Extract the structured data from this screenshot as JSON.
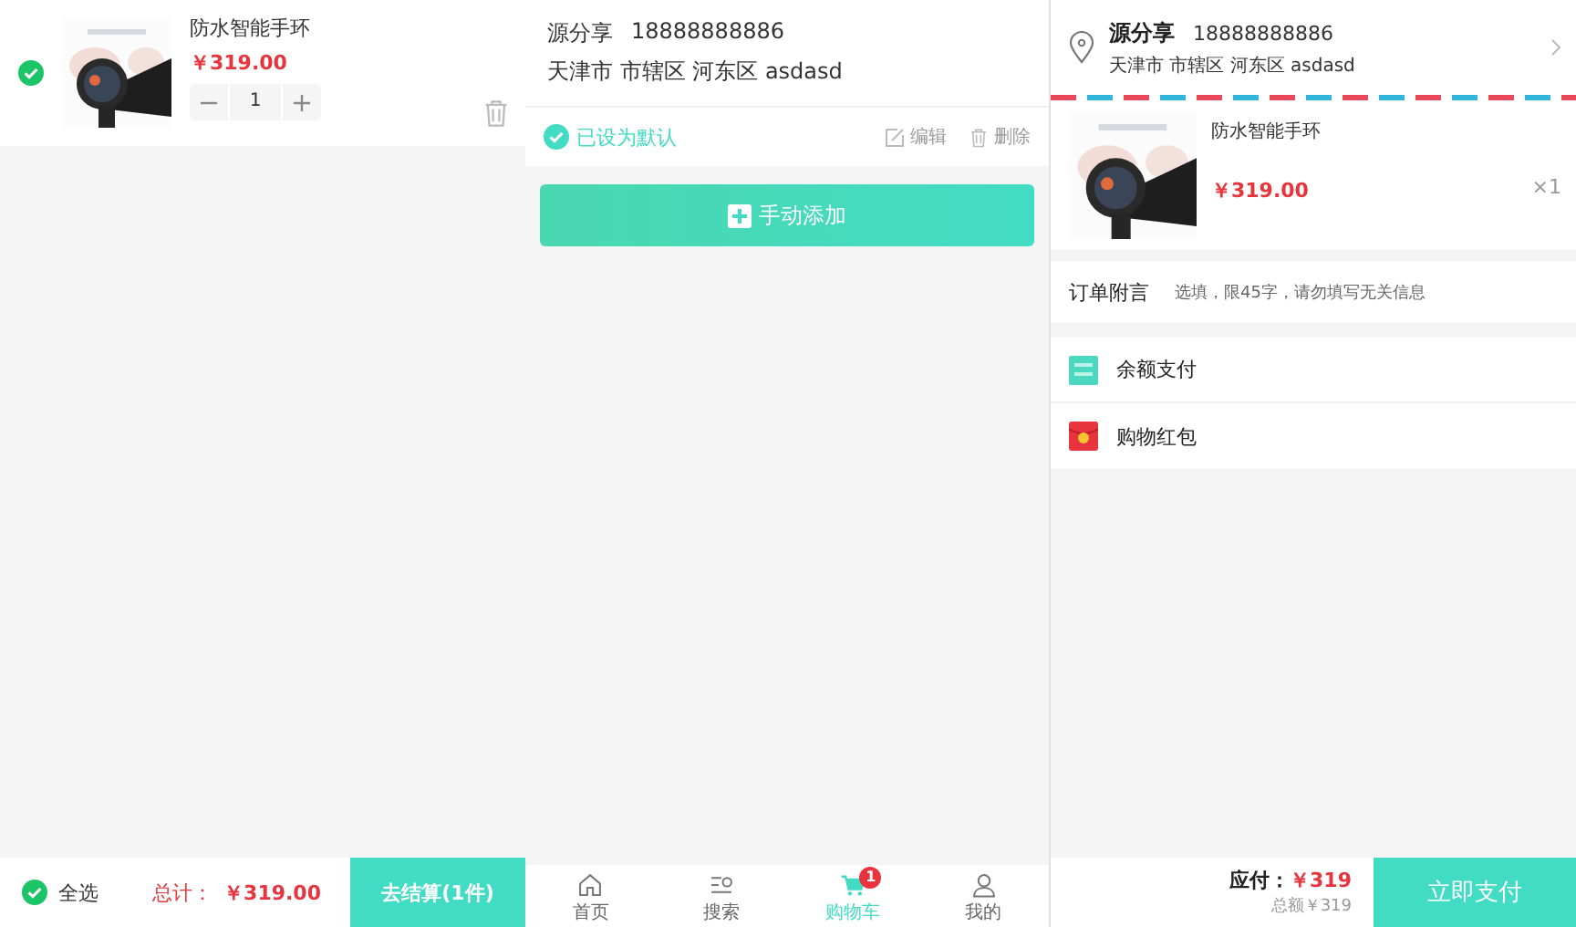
{
  "cart": {
    "items": [
      {
        "title": "防水智能手环",
        "price": "￥319.00",
        "quantity": "1",
        "checked": true
      }
    ],
    "footer": {
      "select_all": {
        "label": "全选",
        "checked": true
      },
      "total_label": "总计：",
      "total": "￥319.00",
      "checkout_button": "去结算(1件)"
    }
  },
  "address_list": {
    "addresses": [
      {
        "name": "源分享",
        "phone": "18888888886",
        "address": "天津市 市辖区 河东区 asdasd",
        "default": true,
        "default_label": "已设为默认",
        "edit": "编辑",
        "delete": "删除"
      }
    ],
    "add_button": "手动添加",
    "tabbar": [
      {
        "label": "首页",
        "kind": "home",
        "selected": false
      },
      {
        "label": "搜索",
        "kind": "search",
        "selected": false
      },
      {
        "label": "购物车",
        "kind": "cart",
        "selected": true,
        "badge": "1"
      },
      {
        "label": "我的",
        "kind": "user",
        "selected": false
      }
    ]
  },
  "checkout": {
    "address": {
      "name": "源分享",
      "phone": "18888888886",
      "address": "天津市 市辖区 河东区 asdasd"
    },
    "items": [
      {
        "title": "防水智能手环",
        "price": "￥319.00",
        "quantity": "×1"
      }
    ],
    "remark": {
      "label": "订单附言",
      "placeholder": "选填，限45字，请勿填写无关信息"
    },
    "payment_options": [
      {
        "label": "余额支付",
        "kind": "balance"
      },
      {
        "label": "购物红包",
        "kind": "red_packet"
      }
    ],
    "footer": {
      "due_label": "应付：",
      "due": "￥319",
      "total_note": "总额￥319",
      "pay_button": "立即支付"
    }
  }
}
